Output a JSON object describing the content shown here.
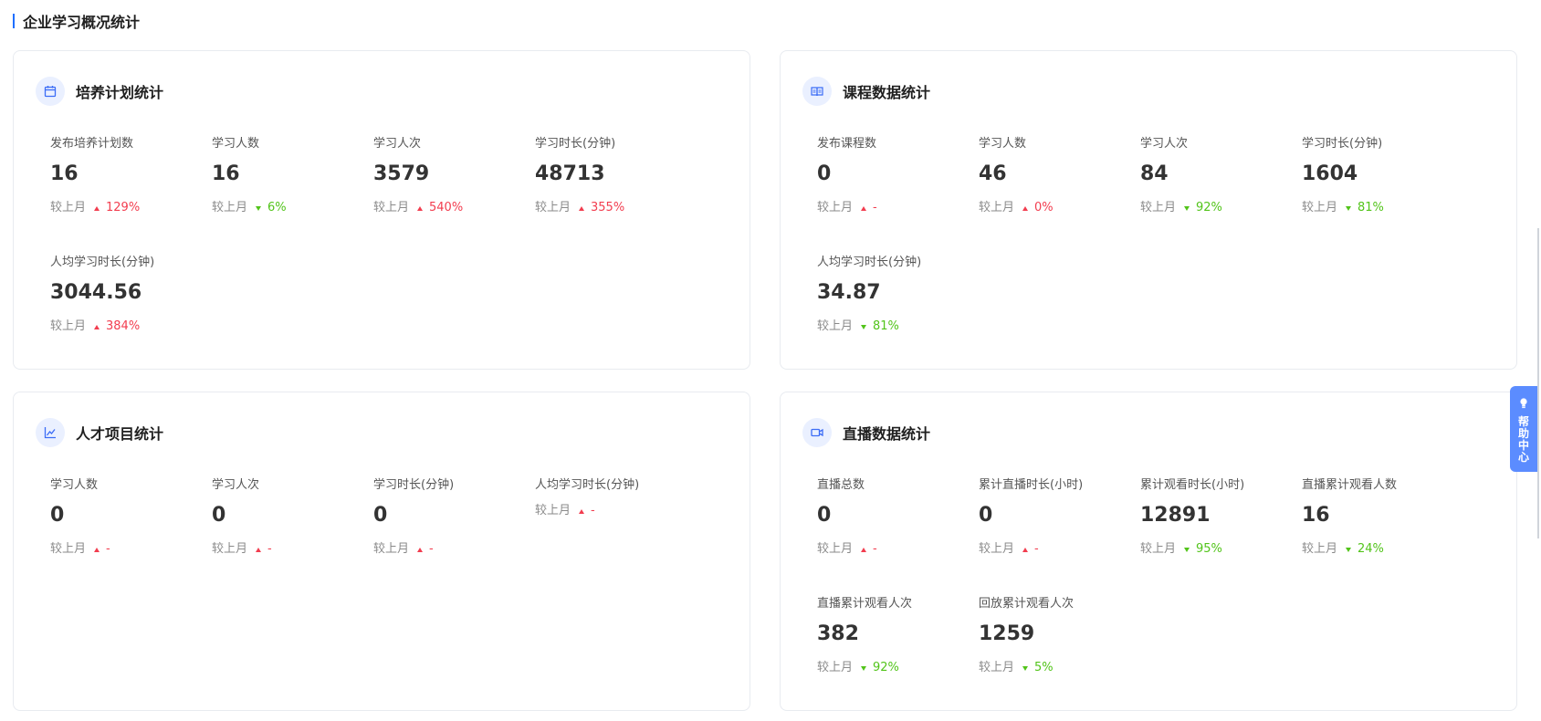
{
  "page": {
    "title": "企业学习概况统计"
  },
  "compare_label": "较上月",
  "help": {
    "label": "帮助中心"
  },
  "cards": {
    "plan": {
      "title": "培养计划统计",
      "metrics": [
        {
          "label": "发布培养计划数",
          "value": "16",
          "trend": "up",
          "pct": "129%"
        },
        {
          "label": "学习人数",
          "value": "16",
          "trend": "down",
          "pct": "6%"
        },
        {
          "label": "学习人次",
          "value": "3579",
          "trend": "up",
          "pct": "540%"
        },
        {
          "label": "学习时长(分钟)",
          "value": "48713",
          "trend": "up",
          "pct": "355%"
        },
        {
          "label": "人均学习时长(分钟)",
          "value": "3044.56",
          "trend": "up",
          "pct": "384%"
        }
      ]
    },
    "course": {
      "title": "课程数据统计",
      "metrics": [
        {
          "label": "发布课程数",
          "value": "0",
          "trend": "up",
          "pct": "-"
        },
        {
          "label": "学习人数",
          "value": "46",
          "trend": "up",
          "pct": "0%"
        },
        {
          "label": "学习人次",
          "value": "84",
          "trend": "down",
          "pct": "92%"
        },
        {
          "label": "学习时长(分钟)",
          "value": "1604",
          "trend": "down",
          "pct": "81%"
        },
        {
          "label": "人均学习时长(分钟)",
          "value": "34.87",
          "trend": "down",
          "pct": "81%"
        }
      ]
    },
    "talent": {
      "title": "人才项目统计",
      "metrics": [
        {
          "label": "学习人数",
          "value": "0",
          "trend": "up",
          "pct": "-"
        },
        {
          "label": "学习人次",
          "value": "0",
          "trend": "up",
          "pct": "-"
        },
        {
          "label": "学习时长(分钟)",
          "value": "0",
          "trend": "up",
          "pct": "-"
        },
        {
          "label": "人均学习时长(分钟)",
          "value": "",
          "trend": "up",
          "pct": "-"
        }
      ]
    },
    "live": {
      "title": "直播数据统计",
      "metrics": [
        {
          "label": "直播总数",
          "value": "0",
          "trend": "up",
          "pct": "-"
        },
        {
          "label": "累计直播时长(小时)",
          "value": "0",
          "trend": "up",
          "pct": "-"
        },
        {
          "label": "累计观看时长(小时)",
          "value": "12891",
          "trend": "down",
          "pct": "95%"
        },
        {
          "label": "直播累计观看人数",
          "value": "16",
          "trend": "down",
          "pct": "24%"
        },
        {
          "label": "直播累计观看人次",
          "value": "382",
          "trend": "down",
          "pct": "92%"
        },
        {
          "label": "回放累计观看人次",
          "value": "1259",
          "trend": "down",
          "pct": "5%"
        }
      ]
    }
  }
}
